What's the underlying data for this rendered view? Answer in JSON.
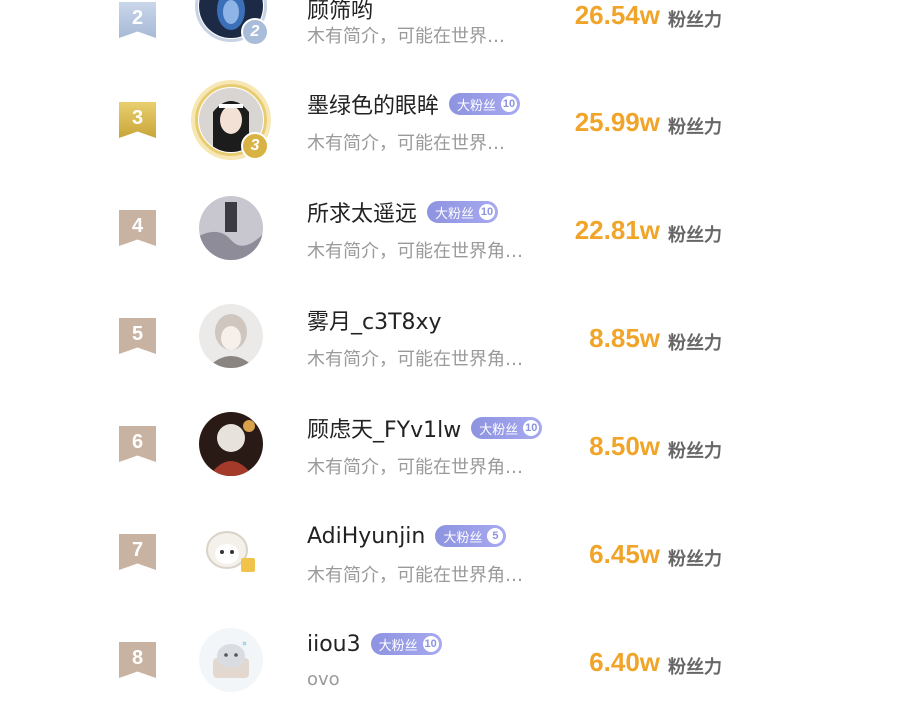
{
  "unit_label": "粉丝力",
  "badge_label": "大粉丝",
  "rows": [
    {
      "rank": "2",
      "name": "顾筛哟",
      "badge_level": "",
      "bio": "木有简介，可能在世界…",
      "score": "26.54w",
      "medal": "2"
    },
    {
      "rank": "3",
      "name": "墨绿色的眼眸",
      "badge_level": "10",
      "bio": "木有简介，可能在世界…",
      "score": "25.99w",
      "medal": "3"
    },
    {
      "rank": "4",
      "name": "所求太遥远",
      "badge_level": "10",
      "bio": "木有简介，可能在世界角…",
      "score": "22.81w"
    },
    {
      "rank": "5",
      "name": "雾月_c3T8xy",
      "badge_level": "",
      "bio": "木有简介，可能在世界角…",
      "score": "8.85w"
    },
    {
      "rank": "6",
      "name": "顾虑天_FYv1lw",
      "badge_level": "10",
      "bio": "木有简介，可能在世界角…",
      "score": "8.50w"
    },
    {
      "rank": "7",
      "name": "AdiHyunjin",
      "badge_level": "5",
      "bio": "木有简介，可能在世界角…",
      "score": "6.45w"
    },
    {
      "rank": "8",
      "name": "iiou3",
      "badge_level": "10",
      "bio": "ovo",
      "score": "6.40w"
    }
  ]
}
